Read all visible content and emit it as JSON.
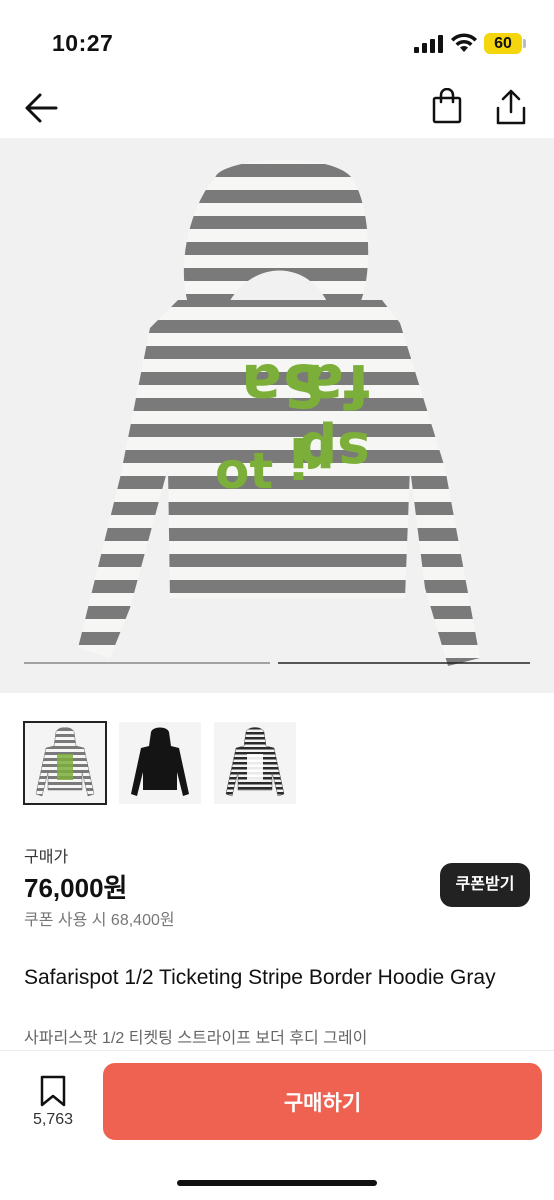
{
  "status_bar": {
    "time": "10:27",
    "battery": "60"
  },
  "nav": {
    "back_icon": "arrow-left-icon",
    "bag_icon": "shopping-bag-icon",
    "share_icon": "share-icon"
  },
  "hero": {
    "image": "striped-hoodie-back-print",
    "print_text": "Safarispot"
  },
  "thumbnails": [
    {
      "image": "gray-striped-hoodie",
      "selected": true
    },
    {
      "image": "black-hoodie",
      "selected": false
    },
    {
      "image": "black-striped-hoodie",
      "selected": false
    }
  ],
  "price": {
    "label": "구매가",
    "amount": "76,000원",
    "coupon_text": "쿠폰 사용 시 68,400원",
    "coupon_button": "쿠폰받기"
  },
  "product": {
    "title_en": "Safarispot 1/2 Ticketing Stripe Border Hoodie Gray",
    "title_ko": "사파리스팟 1/2 티켓팅 스트라이프 보더 후디 그레이"
  },
  "bottom_bar": {
    "like_count": "5,763",
    "buy_label": "구매하기"
  },
  "colors": {
    "accent": "#ef6251",
    "dark": "#222222",
    "print_green": "#7cae3a",
    "battery": "#f5d50b"
  }
}
